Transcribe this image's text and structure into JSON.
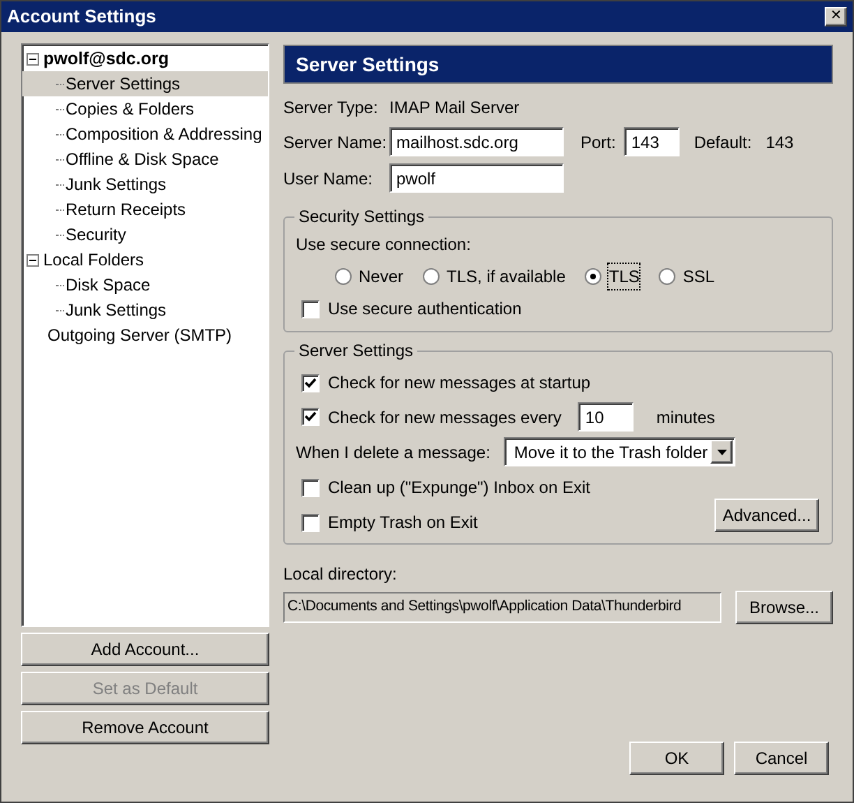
{
  "window": {
    "title": "Account Settings",
    "close": "✕"
  },
  "tree": [
    {
      "label": "pwolf@sdc.org",
      "kind": "account",
      "expanded": true,
      "selected": false,
      "children": [
        {
          "label": "Server Settings",
          "selected": true
        },
        {
          "label": "Copies & Folders",
          "selected": false
        },
        {
          "label": "Composition & Addressing",
          "selected": false
        },
        {
          "label": "Offline & Disk Space",
          "selected": false
        },
        {
          "label": "Junk Settings",
          "selected": false
        },
        {
          "label": "Return Receipts",
          "selected": false
        },
        {
          "label": "Security",
          "selected": false
        }
      ]
    },
    {
      "label": "Local Folders",
      "kind": "folder",
      "expanded": true,
      "selected": false,
      "children": [
        {
          "label": "Disk Space",
          "selected": false
        },
        {
          "label": "Junk Settings",
          "selected": false
        }
      ]
    },
    {
      "label": "Outgoing Server (SMTP)",
      "kind": "folder",
      "selected": false
    }
  ],
  "account_buttons": [
    {
      "label": "Add Account...",
      "disabled": false
    },
    {
      "label": "Set as Default",
      "disabled": true
    },
    {
      "label": "Remove Account",
      "disabled": false
    }
  ],
  "panel": {
    "title": "Server Settings",
    "server_type": {
      "label": "Server Type:",
      "value": "IMAP Mail Server"
    },
    "server_name": {
      "label": "Server Name:",
      "value": "mailhost.sdc.org"
    },
    "port": {
      "label": "Port:",
      "value": "143",
      "default_label": "Default:",
      "default_value": "143"
    },
    "user_name": {
      "label": "User Name:",
      "value": "pwolf"
    },
    "security": {
      "legend": "Security Settings",
      "prompt": "Use secure connection:",
      "options": [
        {
          "label": "Never",
          "selected": false
        },
        {
          "label": "TLS, if available",
          "selected": false
        },
        {
          "label": "TLS",
          "selected": true
        },
        {
          "label": "SSL",
          "selected": false
        }
      ],
      "secure_auth": {
        "label": "Use secure authentication",
        "checked": false
      }
    },
    "server": {
      "legend": "Server Settings",
      "check_startup": {
        "label": "Check for new messages at startup",
        "checked": true
      },
      "check_every": {
        "label": "Check for new messages every",
        "checked": true,
        "value": "10",
        "unit": "minutes"
      },
      "delete": {
        "label": "When I delete a message:",
        "value": "Move it to the Trash folder"
      },
      "expunge": {
        "label": "Clean up (\"Expunge\") Inbox on Exit",
        "checked": false
      },
      "empty_trash": {
        "label": "Empty Trash on Exit",
        "checked": false
      },
      "advanced": "Advanced..."
    },
    "local_directory": {
      "label": "Local directory:",
      "value": "C:\\Documents and Settings\\pwolf\\Application Data\\Thunderbird",
      "browse": "Browse..."
    }
  },
  "buttons": [
    "OK",
    "Cancel"
  ]
}
